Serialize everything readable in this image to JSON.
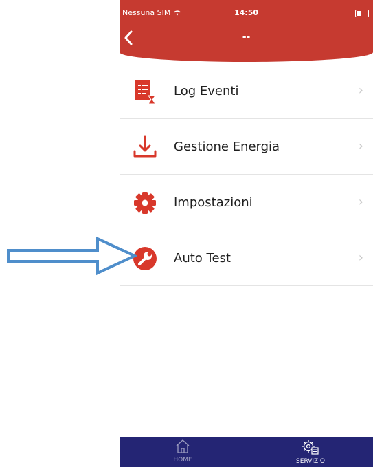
{
  "status_bar": {
    "carrier": "Nessuna SIM",
    "time": "14:50"
  },
  "nav": {
    "back_icon": "chevron-left-icon",
    "title": "--"
  },
  "menu": {
    "items": [
      {
        "label": "Log Eventi",
        "icon": "event-log-icon"
      },
      {
        "label": "Gestione Energia",
        "icon": "download-icon"
      },
      {
        "label": "Impostazioni",
        "icon": "gear-icon"
      },
      {
        "label": "Auto Test",
        "icon": "wrench-icon"
      }
    ],
    "chevron": "›"
  },
  "tab_bar": {
    "items": [
      {
        "label": "HOME",
        "icon": "home-icon"
      },
      {
        "label": "SERVIZIO",
        "icon": "service-gear-icon"
      }
    ]
  },
  "colors": {
    "header": "#c63a30",
    "accent": "#d8382b",
    "tab_bar": "#242574",
    "annotation_arrow": "#4f8ecb"
  }
}
